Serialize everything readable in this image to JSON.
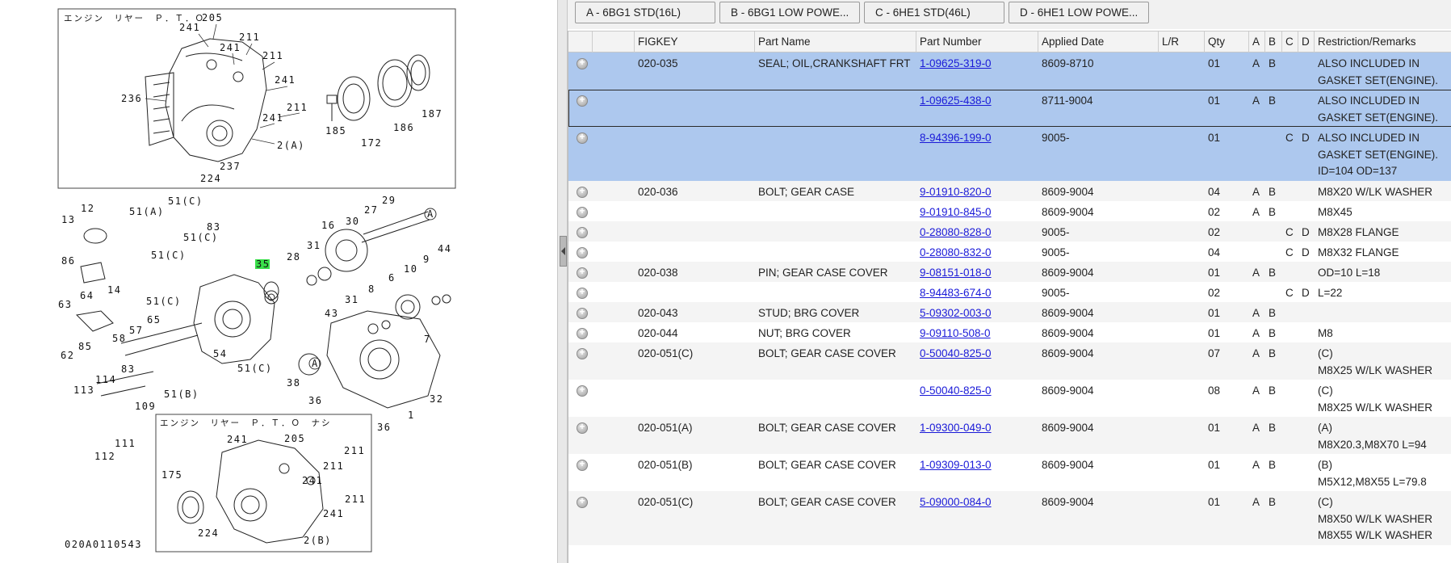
{
  "diagram": {
    "top_box_title": "エンジン　リヤー　Ｐ．Ｔ．Ｏ",
    "bottom_box_title": "エンジン　リヤー　Ｐ．Ｔ．Ｏ　ナシ",
    "figure_id": "020A0110543",
    "labels": {
      "l205a": "205",
      "l241a": "241",
      "l211a": "211",
      "l241b": "241",
      "l211b": "211",
      "l241c": "241",
      "l236": "236",
      "l241d": "241",
      "l211c": "211",
      "l2a": "2(A)",
      "l185": "185",
      "l172": "172",
      "l186": "186",
      "l187": "187",
      "l224a": "224",
      "l237": "237",
      "l12": "12",
      "l13": "13",
      "l51a": "51(A)",
      "l51c1": "51(C)",
      "l83a": "83",
      "l51c2": "51(C)",
      "l51c3": "51(C)",
      "l86": "86",
      "l14": "14",
      "l63": "63",
      "l64": "64",
      "l51c4": "51(C)",
      "l65": "65",
      "l57": "57",
      "l58": "58",
      "l62": "62",
      "l85": "85",
      "l54": "54",
      "l51c5": "51(C)",
      "l35": "35",
      "l29": "29",
      "l27": "27",
      "l30": "30",
      "l16": "16",
      "l28": "28",
      "l31a": "31",
      "l44": "44",
      "l9": "9",
      "l10": "10",
      "l6": "6",
      "l8": "8",
      "l31b": "31",
      "l43": "43",
      "l7": "7",
      "l38": "38",
      "l36a": "36",
      "l36b": "36",
      "l1": "1",
      "l32": "32",
      "l83b": "83",
      "l114": "114",
      "l113": "113",
      "l51b": "51(B)",
      "l109": "109",
      "l111": "111",
      "l112": "112",
      "lA1": "A",
      "lA2": "A",
      "l241e": "241",
      "l205b": "205",
      "l211d": "211",
      "l211e": "211",
      "l241f": "241",
      "l211f": "211",
      "l175": "175",
      "l241g": "241",
      "l224b": "224",
      "l2b": "2(B)"
    }
  },
  "model_tabs": [
    {
      "label": "A - 6BG1 STD(16L)"
    },
    {
      "label": "B - 6BG1 LOW POWE..."
    },
    {
      "label": "C - 6HE1 STD(46L)"
    },
    {
      "label": "D - 6HE1 LOW POWE..."
    }
  ],
  "columns": {
    "figkey": "FIGKEY",
    "part_name": "Part Name",
    "part_number": "Part Number",
    "applied_date": "Applied Date",
    "lr": "L/R",
    "qty": "Qty",
    "a": "A",
    "b": "B",
    "c": "C",
    "d": "D",
    "remarks": "Restriction/Remarks"
  },
  "rows": [
    {
      "figkey": "020-035",
      "part_name": "SEAL; OIL,CRANKSHAFT FRT",
      "part_number": "1-09625-319-0",
      "applied_date": "8609-8710",
      "lr": "",
      "qty": "01",
      "a": "A",
      "b": "B",
      "c": "",
      "d": "",
      "remarks": "ALSO INCLUDED IN\nGASKET SET(ENGINE)."
    },
    {
      "figkey": "",
      "part_name": "",
      "part_number": "1-09625-438-0",
      "applied_date": "8711-9004",
      "lr": "",
      "qty": "01",
      "a": "A",
      "b": "B",
      "c": "",
      "d": "",
      "remarks": "ALSO INCLUDED IN\nGASKET SET(ENGINE)."
    },
    {
      "figkey": "",
      "part_name": "",
      "part_number": "8-94396-199-0",
      "applied_date": "9005-",
      "lr": "",
      "qty": "01",
      "a": "",
      "b": "",
      "c": "C",
      "d": "D",
      "remarks": "ALSO INCLUDED IN\nGASKET SET(ENGINE).\nID=104 OD=137"
    },
    {
      "figkey": "020-036",
      "part_name": "BOLT; GEAR CASE",
      "part_number": "9-01910-820-0",
      "applied_date": "8609-9004",
      "lr": "",
      "qty": "04",
      "a": "A",
      "b": "B",
      "c": "",
      "d": "",
      "remarks": "M8X20 W/LK WASHER"
    },
    {
      "figkey": "",
      "part_name": "",
      "part_number": "9-01910-845-0",
      "applied_date": "8609-9004",
      "lr": "",
      "qty": "02",
      "a": "A",
      "b": "B",
      "c": "",
      "d": "",
      "remarks": "M8X45"
    },
    {
      "figkey": "",
      "part_name": "",
      "part_number": "0-28080-828-0",
      "applied_date": "9005-",
      "lr": "",
      "qty": "02",
      "a": "",
      "b": "",
      "c": "C",
      "d": "D",
      "remarks": "M8X28 FLANGE"
    },
    {
      "figkey": "",
      "part_name": "",
      "part_number": "0-28080-832-0",
      "applied_date": "9005-",
      "lr": "",
      "qty": "04",
      "a": "",
      "b": "",
      "c": "C",
      "d": "D",
      "remarks": "M8X32 FLANGE"
    },
    {
      "figkey": "020-038",
      "part_name": "PIN; GEAR CASE COVER",
      "part_number": "9-08151-018-0",
      "applied_date": "8609-9004",
      "lr": "",
      "qty": "01",
      "a": "A",
      "b": "B",
      "c": "",
      "d": "",
      "remarks": "OD=10 L=18"
    },
    {
      "figkey": "",
      "part_name": "",
      "part_number": "8-94483-674-0",
      "applied_date": "9005-",
      "lr": "",
      "qty": "02",
      "a": "",
      "b": "",
      "c": "C",
      "d": "D",
      "remarks": "L=22"
    },
    {
      "figkey": "020-043",
      "part_name": "STUD; BRG COVER",
      "part_number": "5-09302-003-0",
      "applied_date": "8609-9004",
      "lr": "",
      "qty": "01",
      "a": "A",
      "b": "B",
      "c": "",
      "d": "",
      "remarks": ""
    },
    {
      "figkey": "020-044",
      "part_name": "NUT; BRG COVER",
      "part_number": "9-09110-508-0",
      "applied_date": "8609-9004",
      "lr": "",
      "qty": "01",
      "a": "A",
      "b": "B",
      "c": "",
      "d": "",
      "remarks": "M8"
    },
    {
      "figkey": "020-051(C)",
      "part_name": "BOLT; GEAR CASE COVER",
      "part_number": "0-50040-825-0",
      "applied_date": "8609-9004",
      "lr": "",
      "qty": "07",
      "a": "A",
      "b": "B",
      "c": "",
      "d": "",
      "remarks": "(C)\nM8X25 W/LK WASHER"
    },
    {
      "figkey": "",
      "part_name": "",
      "part_number": "0-50040-825-0",
      "applied_date": "8609-9004",
      "lr": "",
      "qty": "08",
      "a": "A",
      "b": "B",
      "c": "",
      "d": "",
      "remarks": "(C)\nM8X25 W/LK WASHER"
    },
    {
      "figkey": "020-051(A)",
      "part_name": "BOLT; GEAR CASE COVER",
      "part_number": "1-09300-049-0",
      "applied_date": "8609-9004",
      "lr": "",
      "qty": "01",
      "a": "A",
      "b": "B",
      "c": "",
      "d": "",
      "remarks": "(A)\nM8X20.3,M8X70 L=94"
    },
    {
      "figkey": "020-051(B)",
      "part_name": "BOLT; GEAR CASE COVER",
      "part_number": "1-09309-013-0",
      "applied_date": "8609-9004",
      "lr": "",
      "qty": "01",
      "a": "A",
      "b": "B",
      "c": "",
      "d": "",
      "remarks": "(B)\nM5X12,M8X55 L=79.8"
    },
    {
      "figkey": "020-051(C)",
      "part_name": "BOLT; GEAR CASE COVER",
      "part_number": "5-09000-084-0",
      "applied_date": "8609-9004",
      "lr": "",
      "qty": "01",
      "a": "A",
      "b": "B",
      "c": "",
      "d": "",
      "remarks": "(C)\nM8X50 W/LK WASHER\nM8X55 W/LK WASHER"
    }
  ],
  "colors": {
    "selected_row": "#adc8ee",
    "link": "#1a1ad8",
    "highlight_callout": "#39e04a"
  }
}
